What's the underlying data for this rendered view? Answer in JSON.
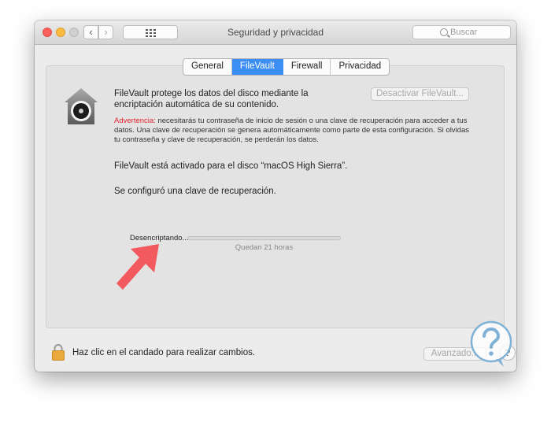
{
  "window": {
    "title": "Seguridad y privacidad"
  },
  "toolbar": {
    "back_icon": "‹",
    "forward_icon": "›",
    "search_placeholder": "Buscar"
  },
  "tabs": [
    {
      "label": "General",
      "active": false
    },
    {
      "label": "FileVault",
      "active": true
    },
    {
      "label": "Firewall",
      "active": false
    },
    {
      "label": "Privacidad",
      "active": false
    }
  ],
  "filevault": {
    "heading": "FileVault protege los datos del disco mediante la encriptación automática de su contenido.",
    "deactivate_button": "Desactivar FileVault...",
    "warning_label": "Advertencia:",
    "warning_text": " necesitarás tu contraseña de inicio de sesión o una clave de recuperación para acceder a tus datos. Una clave de recuperación se genera automáticamente como parte de esta configuración. Si olvidas tu contraseña y clave de recuperación, se perderán los datos.",
    "status_enabled": "FileVault está activado para el disco “macOS High Sierra”.",
    "status_recovery_key": "Se configuró una clave de recuperación.",
    "progress_label": "Desencriptando...",
    "progress_value": 0,
    "progress_remaining": "Quedan 21 horas"
  },
  "footer": {
    "lock_text": "Haz clic en el candado para realizar cambios.",
    "advanced_button": "Avanzado...",
    "help_label": "?"
  },
  "colors": {
    "accent": "#3d8ef2",
    "warning": "#e0242a",
    "arrow": "#f25a5f"
  }
}
